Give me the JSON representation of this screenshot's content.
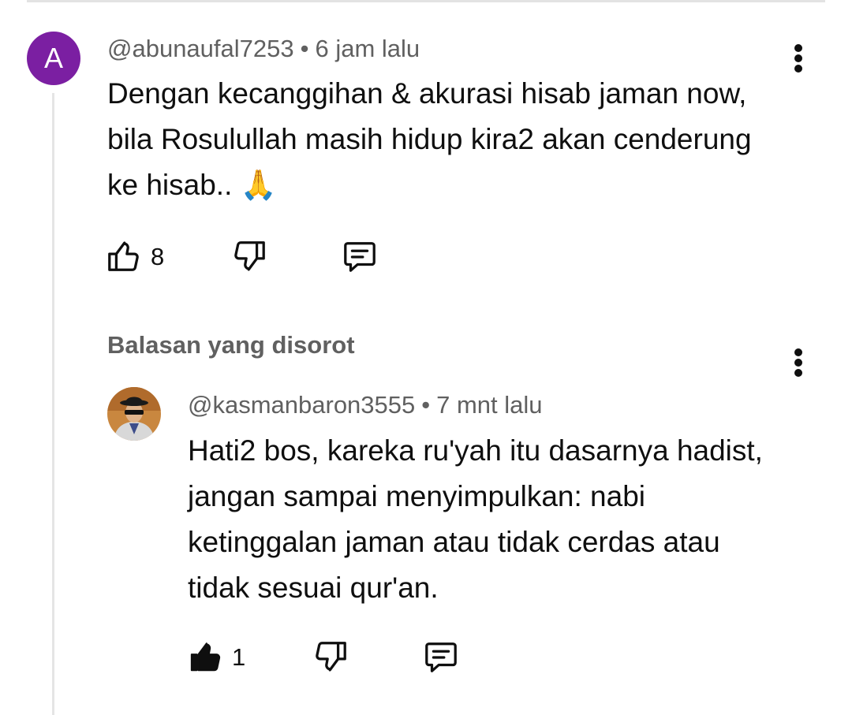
{
  "comment": {
    "avatar_letter": "A",
    "author": "@abunaufal7253",
    "separator": "•",
    "time": "6 jam lalu",
    "lines": [
      "Dengan kecanggihan & akurasi hisab jaman now,",
      "bila Rosulullah masih hidup kira2 akan cenderung",
      "ke hisab.. 🙏"
    ],
    "like_count": "8"
  },
  "highlighted_reply": {
    "label": "Balasan yang disorot",
    "author": "@kasmanbaron3555",
    "separator": "•",
    "time": "7 mnt lalu",
    "lines": [
      "Hati2 bos, kareka ru'yah itu dasarnya hadist,",
      "jangan sampai menyimpulkan:  nabi",
      "ketinggalan jaman atau tidak cerdas atau",
      "tidak sesuai qur'an."
    ],
    "like_count": "1",
    "like_state": "liked"
  },
  "colors": {
    "avatar_bg": "#7b1fa2",
    "meta_text": "#606060",
    "text": "#0f0f0f",
    "thread_line": "#e5e5e5"
  },
  "icons": [
    "kebab-menu-icon",
    "thumbs-up-icon",
    "thumbs-down-icon",
    "reply-icon"
  ]
}
